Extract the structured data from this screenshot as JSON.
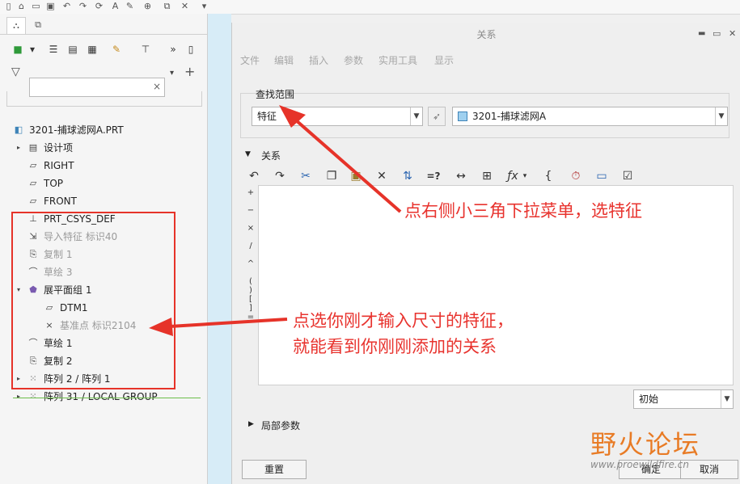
{
  "toolbar": {
    "icons": [
      "new-icon",
      "open-icon",
      "folder-icon",
      "save-icon",
      "undo-icon",
      "redo-icon",
      "regenerate-icon",
      "annotation-icon",
      "sketch-icon",
      "zoom-icon",
      "window-icon",
      "close-window-icon",
      "more-icon"
    ]
  },
  "left_panel": {
    "tabs": [
      "model-tree-tab",
      "layer-tab"
    ],
    "filter": {
      "value": "",
      "clear": "×"
    },
    "tree": [
      {
        "label": "3201-捕球滤网A.PRT",
        "indent": 0,
        "expander": "",
        "icon": "part-icon",
        "dim": false
      },
      {
        "label": "设计项",
        "indent": 1,
        "expander": "▸",
        "icon": "design-items-icon",
        "dim": false
      },
      {
        "label": "RIGHT",
        "indent": 1,
        "expander": "",
        "icon": "datum-plane-icon",
        "dim": false
      },
      {
        "label": "TOP",
        "indent": 1,
        "expander": "",
        "icon": "datum-plane-icon",
        "dim": false
      },
      {
        "label": "FRONT",
        "indent": 1,
        "expander": "",
        "icon": "datum-plane-icon",
        "dim": false
      },
      {
        "label": "PRT_CSYS_DEF",
        "indent": 1,
        "expander": "",
        "icon": "csys-icon",
        "dim": false
      },
      {
        "label": "导入特征 标识40",
        "indent": 1,
        "expander": "",
        "icon": "import-feature-icon",
        "dim": true
      },
      {
        "label": "复制 1",
        "indent": 1,
        "expander": "",
        "icon": "copy-icon",
        "dim": true
      },
      {
        "label": "草绘 3",
        "indent": 1,
        "expander": "",
        "icon": "sketch-icon",
        "dim": true
      },
      {
        "label": "展平面组 1",
        "indent": 1,
        "expander": "▾",
        "icon": "flatten-quilt-icon",
        "dim": false
      },
      {
        "label": "DTM1",
        "indent": 2,
        "expander": "",
        "icon": "datum-plane-icon",
        "dim": false
      },
      {
        "label": "基准点 标识2104",
        "indent": 2,
        "expander": "",
        "icon": "datum-point-icon",
        "dim": true
      },
      {
        "label": "草绘 1",
        "indent": 1,
        "expander": "",
        "icon": "sketch-icon",
        "dim": false
      },
      {
        "label": "复制 2",
        "indent": 1,
        "expander": "",
        "icon": "copy-icon",
        "dim": false
      },
      {
        "label": "阵列 2 / 阵列 1",
        "indent": 1,
        "expander": "▸",
        "icon": "pattern-icon",
        "dim": false
      },
      {
        "label": "阵列 31 / LOCAL GROUP",
        "indent": 1,
        "expander": "▸",
        "icon": "pattern-icon",
        "dim": false
      }
    ]
  },
  "dialog": {
    "title": "关系",
    "window_buttons": [
      "▬",
      "▭",
      "✕"
    ],
    "menu": [
      "文件",
      "编辑",
      "插入",
      "参数",
      "实用工具",
      "显示"
    ],
    "scope_label": "查找范围",
    "scope_type": "特征",
    "scope_object": "3201-捕球滤网A",
    "relations_label": "关系",
    "operators": [
      "+",
      "−",
      "×",
      "/",
      "^",
      "( )",
      "[ ]",
      "="
    ],
    "sort_value": "初始",
    "local_params_label": "局部参数",
    "buttons": {
      "reset": "重置",
      "ok": "确定",
      "cancel": "取消"
    }
  },
  "annotations": {
    "note1": "点右侧小三角下拉菜单，选特征",
    "note2_line1": "点选你刚才输入尺寸的特征，",
    "note2_line2": "就能看到你刚刚添加的关系"
  },
  "watermark": {
    "text": "野火论坛",
    "url": "www.proewildfire.cn"
  },
  "colors": {
    "annotation_red": "#e8332e",
    "watermark_orange": "#e87b25"
  }
}
